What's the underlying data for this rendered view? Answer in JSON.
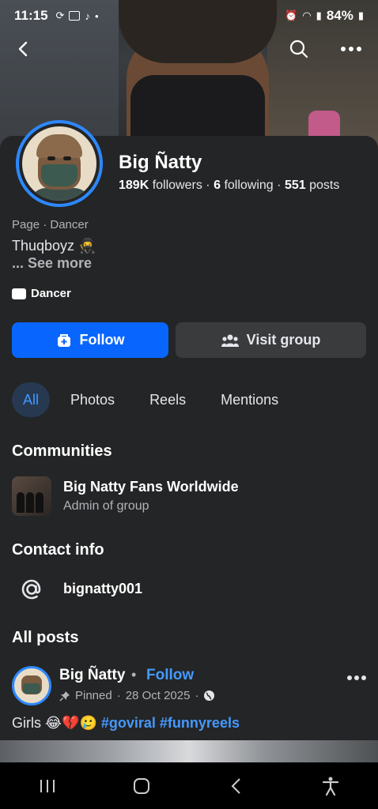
{
  "status_bar": {
    "time": "11:15",
    "battery": "84%"
  },
  "profile": {
    "name": "Big Ñatty",
    "followers_count": "189K",
    "followers_label": "followers",
    "following_count": "6",
    "following_label": "following",
    "posts_count": "551",
    "posts_label": "posts",
    "category": "Page · Dancer",
    "bio": "Thuqboyz 🥷",
    "see_more": "... See more",
    "tag": "Dancer"
  },
  "actions": {
    "follow_label": "Follow",
    "visit_group_label": "Visit group"
  },
  "tabs": [
    {
      "label": "All",
      "active": true
    },
    {
      "label": "Photos",
      "active": false
    },
    {
      "label": "Reels",
      "active": false
    },
    {
      "label": "Mentions",
      "active": false
    }
  ],
  "communities": {
    "title": "Communities",
    "items": [
      {
        "name": "Big Natty Fans Worldwide",
        "role": "Admin of group"
      }
    ]
  },
  "contact": {
    "title": "Contact info",
    "handle": "bignatty001"
  },
  "posts": {
    "title": "All posts",
    "items": [
      {
        "author": "Big Ñatty",
        "follow_label": "Follow",
        "pinned_label": "Pinned",
        "date": "28 Oct 2025",
        "text": "Girls 😂💔🥲",
        "hashtags": [
          "#goviral",
          "#funnyreels"
        ]
      }
    ]
  },
  "colors": {
    "accent": "#0866ff",
    "link": "#4599ff",
    "background": "#242526",
    "ring": "#2d88ff"
  },
  "icons": [
    "back-icon",
    "search-icon",
    "more-icon",
    "follow-icon",
    "group-icon",
    "at-icon",
    "pin-icon",
    "globe-icon",
    "recents-icon",
    "home-icon",
    "back-nav-icon",
    "accessibility-icon"
  ]
}
